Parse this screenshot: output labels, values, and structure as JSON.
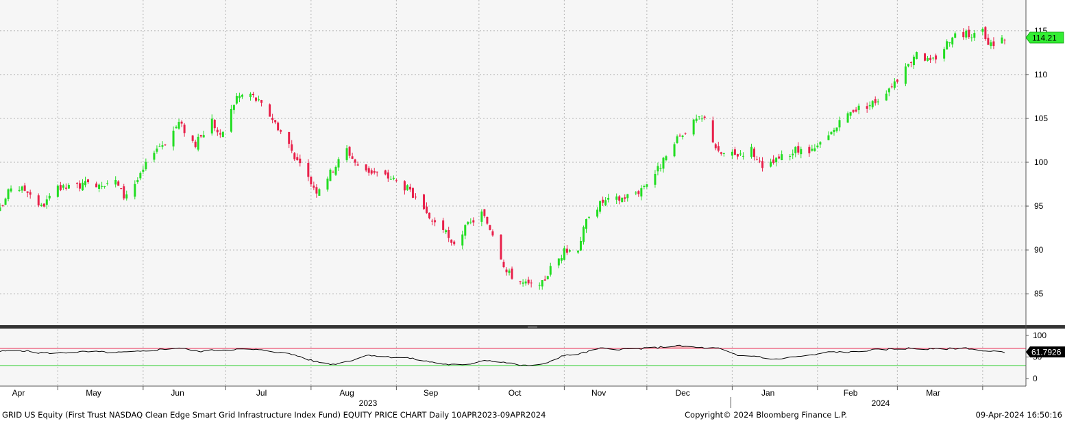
{
  "chart_data": {
    "type": "candlestick",
    "title": "GRID US Equity (First Trust NASDAQ Clean Edge Smart Grid Infrastructure Index Fund) EQUITY PRICE CHART",
    "frequency": "Daily",
    "range_label": "10APR2023-09APR2024",
    "ticker": "GRID US Equity",
    "colors": {
      "up": "#22dd22",
      "down": "#e8204a",
      "rsi_line": "#000000",
      "overbought": "#e8204a",
      "oversold": "#22cc22",
      "last_price_label": "#33ee33"
    },
    "price_axis": {
      "ticks": [
        85,
        90,
        95,
        100,
        105,
        110,
        115
      ],
      "range": [
        81.5,
        118.5
      ]
    },
    "last_price": "114.21",
    "price_path": [
      [
        "2023-04-10",
        94.5
      ],
      [
        "2023-04-14",
        97.2
      ],
      [
        "2023-04-20",
        96.8
      ],
      [
        "2023-04-25",
        94.9
      ],
      [
        "2023-05-01",
        96.9
      ],
      [
        "2023-05-08",
        97.3
      ],
      [
        "2023-05-15",
        97.6
      ],
      [
        "2023-05-22",
        97.8
      ],
      [
        "2023-05-25",
        96.1
      ],
      [
        "2023-05-31",
        98.4
      ],
      [
        "2023-06-05",
        101.5
      ],
      [
        "2023-06-09",
        102.3
      ],
      [
        "2023-06-14",
        104.5
      ],
      [
        "2023-06-20",
        102.0
      ],
      [
        "2023-06-26",
        104.8
      ],
      [
        "2023-06-29",
        102.8
      ],
      [
        "2023-07-05",
        107.5
      ],
      [
        "2023-07-10",
        107.8
      ],
      [
        "2023-07-14",
        106.5
      ],
      [
        "2023-07-18",
        105.0
      ],
      [
        "2023-07-24",
        102.0
      ],
      [
        "2023-07-28",
        99.5
      ],
      [
        "2023-08-03",
        96.8
      ],
      [
        "2023-08-09",
        99.2
      ],
      [
        "2023-08-14",
        101.5
      ],
      [
        "2023-08-18",
        99.5
      ],
      [
        "2023-08-24",
        98.8
      ],
      [
        "2023-08-30",
        98.2
      ],
      [
        "2023-09-05",
        97.0
      ],
      [
        "2023-09-12",
        93.8
      ],
      [
        "2023-09-18",
        92.5
      ],
      [
        "2023-09-21",
        90.5
      ],
      [
        "2023-09-27",
        92.8
      ],
      [
        "2023-10-02",
        94.2
      ],
      [
        "2023-10-06",
        92.0
      ],
      [
        "2023-10-11",
        87.5
      ],
      [
        "2023-10-17",
        86.2
      ],
      [
        "2023-10-23",
        85.6
      ],
      [
        "2023-10-27",
        87.9
      ],
      [
        "2023-11-01",
        89.8
      ],
      [
        "2023-11-06",
        90.3
      ],
      [
        "2023-11-10",
        94.2
      ],
      [
        "2023-11-15",
        95.5
      ],
      [
        "2023-11-21",
        95.8
      ],
      [
        "2023-11-28",
        96.7
      ],
      [
        "2023-12-04",
        98.8
      ],
      [
        "2023-12-08",
        100.5
      ],
      [
        "2023-12-13",
        103.0
      ],
      [
        "2023-12-19",
        104.8
      ],
      [
        "2023-12-22",
        104.9
      ],
      [
        "2023-12-27",
        101.0
      ],
      [
        "2024-01-02",
        100.8
      ],
      [
        "2024-01-08",
        101.5
      ],
      [
        "2024-01-12",
        99.1
      ],
      [
        "2024-01-18",
        100.4
      ],
      [
        "2024-01-24",
        101.3
      ],
      [
        "2024-01-30",
        101.1
      ],
      [
        "2024-02-05",
        102.9
      ],
      [
        "2024-02-09",
        104.4
      ],
      [
        "2024-02-14",
        106.0
      ],
      [
        "2024-02-20",
        106.6
      ],
      [
        "2024-02-23",
        107.2
      ],
      [
        "2024-02-28",
        108.9
      ],
      [
        "2024-03-04",
        110.5
      ],
      [
        "2024-03-08",
        112.8
      ],
      [
        "2024-03-13",
        111.3
      ],
      [
        "2024-03-18",
        113.1
      ],
      [
        "2024-03-21",
        114.6
      ],
      [
        "2024-03-27",
        114.6
      ],
      [
        "2024-04-01",
        114.8
      ],
      [
        "2024-04-03",
        113.3
      ],
      [
        "2024-04-09",
        114.21
      ]
    ],
    "rsi": {
      "axis_ticks": [
        0,
        50,
        100
      ],
      "overbought": 70,
      "oversold": 30,
      "last_value": "61.7926",
      "path": [
        [
          "2023-04-10",
          63
        ],
        [
          "2023-04-17",
          66
        ],
        [
          "2023-04-24",
          60
        ],
        [
          "2023-05-01",
          59
        ],
        [
          "2023-05-08",
          62
        ],
        [
          "2023-05-15",
          62
        ],
        [
          "2023-05-22",
          60
        ],
        [
          "2023-06-01",
          63
        ],
        [
          "2023-06-08",
          68
        ],
        [
          "2023-06-14",
          71
        ],
        [
          "2023-06-21",
          63
        ],
        [
          "2023-06-28",
          66
        ],
        [
          "2023-07-05",
          68
        ],
        [
          "2023-07-12",
          67
        ],
        [
          "2023-07-19",
          62
        ],
        [
          "2023-07-26",
          55
        ],
        [
          "2023-08-02",
          40
        ],
        [
          "2023-08-09",
          33
        ],
        [
          "2023-08-15",
          41
        ],
        [
          "2023-08-22",
          55
        ],
        [
          "2023-08-29",
          50
        ],
        [
          "2023-09-05",
          48
        ],
        [
          "2023-09-12",
          40
        ],
        [
          "2023-09-19",
          33
        ],
        [
          "2023-09-26",
          31
        ],
        [
          "2023-10-03",
          43
        ],
        [
          "2023-10-10",
          38
        ],
        [
          "2023-10-17",
          30
        ],
        [
          "2023-10-24",
          32
        ],
        [
          "2023-10-31",
          52
        ],
        [
          "2023-11-07",
          58
        ],
        [
          "2023-11-14",
          70
        ],
        [
          "2023-11-21",
          68
        ],
        [
          "2023-11-28",
          69
        ],
        [
          "2023-12-05",
          72
        ],
        [
          "2023-12-12",
          76
        ],
        [
          "2023-12-19",
          72
        ],
        [
          "2023-12-27",
          70
        ],
        [
          "2024-01-03",
          53
        ],
        [
          "2024-01-10",
          52
        ],
        [
          "2024-01-16",
          44
        ],
        [
          "2024-01-23",
          50
        ],
        [
          "2024-01-30",
          54
        ],
        [
          "2024-02-06",
          62
        ],
        [
          "2024-02-13",
          61
        ],
        [
          "2024-02-20",
          66
        ],
        [
          "2024-02-27",
          68
        ],
        [
          "2024-03-05",
          70
        ],
        [
          "2024-03-12",
          68
        ],
        [
          "2024-03-19",
          69
        ],
        [
          "2024-03-26",
          71
        ],
        [
          "2024-04-02",
          63
        ],
        [
          "2024-04-09",
          61.79
        ]
      ]
    },
    "x_axis": {
      "start": "2023-04-10",
      "end": "2024-04-09",
      "month_labels": [
        "Apr",
        "May",
        "Jun",
        "Jul",
        "Aug",
        "Sep",
        "Oct",
        "Nov",
        "Dec",
        "Jan",
        "Feb",
        "Mar"
      ],
      "year_labels": [
        "2023",
        "2024"
      ]
    }
  },
  "footer": {
    "chart_title": "GRID US Equity (First Trust NASDAQ Clean Edge Smart Grid Infrastructure Index Fund) EQUITY PRICE CHART  Daily 10APR2023-09APR2024",
    "copyright": "Copyright© 2024 Bloomberg Finance L.P.",
    "timestamp": "09-Apr-2024 16:50:16"
  }
}
